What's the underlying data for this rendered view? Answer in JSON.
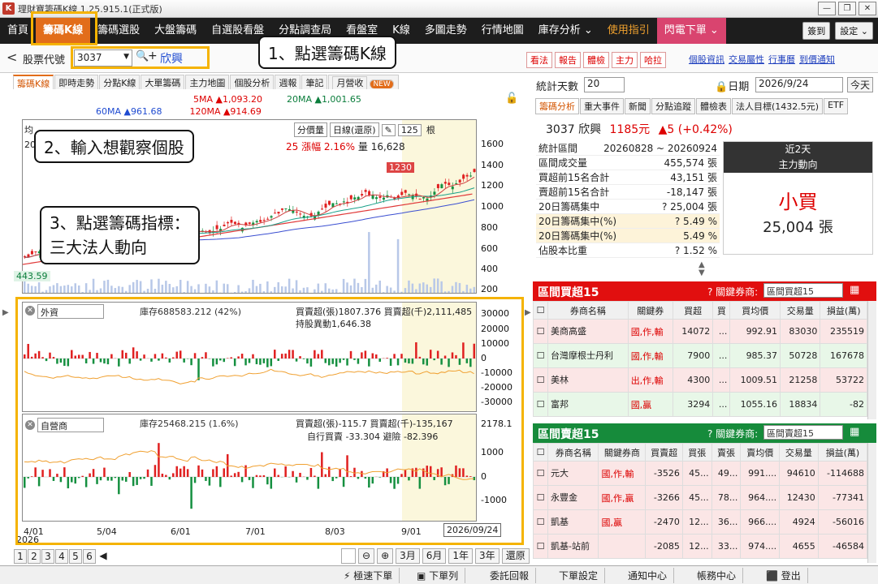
{
  "window": {
    "title": "理財寶籌碼K線 1.25.915.1(正式版)",
    "logo": "K"
  },
  "menu": {
    "items": [
      "首頁",
      "籌碼K線",
      "籌碼選股",
      "大盤籌碼",
      "自選股看盤",
      "分點調查局",
      "看盤室",
      "K線",
      "多圖走勢",
      "行情地圖",
      "庫存分析 ⌄",
      "使用指引",
      "閃電下單 ⌄"
    ],
    "right": [
      "簽到",
      "設定 ⌄"
    ]
  },
  "sub": {
    "back": "<",
    "code_label": "股票代號",
    "code_value": "3037",
    "stock_name": "欣興",
    "right_buttons": [
      "看法",
      "報告",
      "體檢",
      "主力",
      "哈拉"
    ],
    "right_links": [
      "個股資訊",
      "交易屬性",
      "行事曆",
      "到價通知"
    ]
  },
  "chart_tabs": {
    "items": [
      "籌碼K線",
      "即時走勢",
      "分點K線",
      "大單籌碼",
      "主力地圖",
      "個股分析",
      "週報",
      "筆記",
      "月營收"
    ],
    "new_badge": "NEW"
  },
  "ma": {
    "ma5": "5MA ▲1,093.20",
    "ma20": "20MA ▲1,001.65",
    "ma60": "60MA ▲961.68",
    "ma120": "120MA ▲914.69"
  },
  "price_ctl": {
    "vol": "分價量",
    "period": "日線(還原)",
    "count": "125",
    "count_unit": "根"
  },
  "price_info": {
    "pct": "25",
    "amp": "漲幅 2.16%",
    "vol": "量 16,628",
    "peak": "1230",
    "low": "443.59",
    "top_left": "均",
    "num20": "20"
  },
  "axes": {
    "price": [
      "1600",
      "1400",
      "1200",
      "1000",
      "800",
      "600",
      "400",
      "200"
    ],
    "foreign": [
      "30000",
      "20000",
      "10000",
      "0",
      "-10000",
      "-20000",
      "-30000"
    ],
    "dealer": [
      "2178.1",
      "1000",
      "0",
      "-1000"
    ]
  },
  "foreign": {
    "select": "外資",
    "inv": "庫存688583.212 (42%)",
    "bs": "買賣超(張)1807.376 買賣超(千)2,111,485",
    "hold": "持股異動1,646.38"
  },
  "dealer": {
    "select": "自營商",
    "inv": "庫存25468.215 (1.6%)",
    "bs": "買賣超(張)-115.7 買賣超(千)-135,167",
    "self": "自行買賣 -33.304 避險 -82.396"
  },
  "xaxis": {
    "labels": [
      "2026",
      "5/04",
      "6/01",
      "7/01",
      "8/03",
      "9/01"
    ],
    "sub": "4/01",
    "date": "2026/09/24"
  },
  "pager": [
    "1",
    "2",
    "3",
    "4",
    "5",
    "6"
  ],
  "zoom": {
    "btns": [
      "3月",
      "6月",
      "1年",
      "3年"
    ],
    "restore": "還原"
  },
  "annotations": {
    "a1": "1、點選籌碼K線",
    "a2": "2、輸入想觀察個股",
    "a3_1": "3、點選籌碼指標：",
    "a3_2": "三大法人動向"
  },
  "right": {
    "stat_days_label": "統計天數",
    "stat_days": "20",
    "date_label": "日期",
    "date": "2026/9/24",
    "today": "今天",
    "tabs": [
      "籌碼分析",
      "重大事件",
      "新聞",
      "分點追蹤",
      "體檢表",
      "法人目標(1432.5元)",
      "ETF"
    ],
    "stock": "3037 欣興",
    "price": "1185元",
    "change": "▲5 (+0.42%)",
    "stats": [
      [
        "統計區間",
        "20260828 ~ 20260924"
      ],
      [
        "區間成交量",
        "455,574 張"
      ],
      [
        "買超前15名合計",
        "43,151 張"
      ],
      [
        "賣超前15名合計",
        "-18,147 張"
      ],
      [
        "20日籌碼集中",
        "?  25,004 張"
      ],
      [
        "20日籌碼集中(%)",
        "?  5.49 %"
      ],
      [
        "20日籌碼集中(%)",
        "5.49 %"
      ],
      [
        "佔股本比重",
        "?  1.52 %"
      ]
    ],
    "mf_title1": "近2天",
    "mf_title2": "主力動向",
    "mf_big": "小買",
    "mf_val": "25,004 張"
  },
  "buy": {
    "title": "區間買超15",
    "kb": "? 關鍵券商:",
    "ksel": "區間買超15",
    "head": [
      "券商名稱",
      "關鍵券",
      "買超",
      "買",
      "買均價",
      "交易量",
      "損益(萬)"
    ],
    "rows": [
      [
        "美商高盛",
        "國,作,輸",
        "14072",
        "...",
        "992.91",
        "83030",
        "235519"
      ],
      [
        "台灣摩根士丹利",
        "國,作,輸",
        "7900",
        "...",
        "985.37",
        "50728",
        "167678"
      ],
      [
        "美林",
        "出,作,輸",
        "4300",
        "...",
        "1009.51",
        "21258",
        "53722"
      ],
      [
        "富邦",
        "國,贏",
        "3294",
        "...",
        "1055.16",
        "18834",
        "-82"
      ]
    ]
  },
  "sell": {
    "title": "區間賣超15",
    "kb": "? 關鍵券商:",
    "ksel": "區間賣超15",
    "head": [
      "券商名稱",
      "關鍵券商",
      "買賣超",
      "買張",
      "賣張",
      "賣均價",
      "交易量",
      "損益(萬)"
    ],
    "rows": [
      [
        "元大",
        "國,作,輸",
        "-3526",
        "45...",
        "49...",
        "991....",
        "94610",
        "-114688"
      ],
      [
        "永豐金",
        "國,作,贏",
        "-3266",
        "45...",
        "78...",
        "964....",
        "12430",
        "-77341"
      ],
      [
        "凱基",
        "國,贏",
        "-2470",
        "12...",
        "36...",
        "966....",
        "4924",
        "-56016"
      ],
      [
        "凱基-站前",
        "",
        "-2085",
        "12...",
        "33...",
        "974....",
        "4655",
        "-46584"
      ]
    ]
  },
  "bottom": [
    "極速下單",
    "下單列",
    "委託回報",
    "下單設定",
    "通知中心",
    "帳務中心",
    "登出"
  ]
}
